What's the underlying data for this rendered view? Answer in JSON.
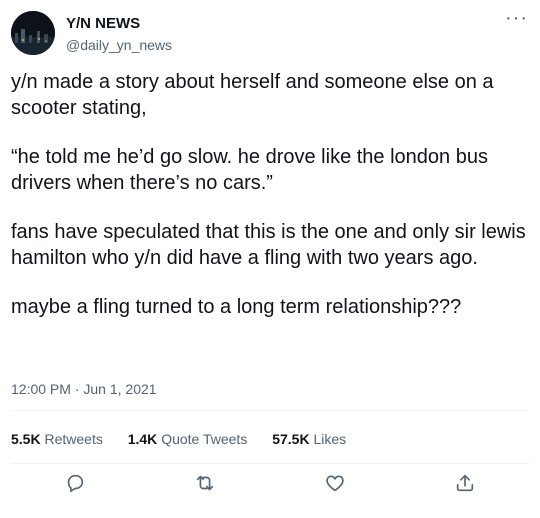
{
  "tweet": {
    "author_name": "Y/N NEWS",
    "author_handle": "@daily_yn_news",
    "more_label": "···",
    "paragraphs": [
      "y/n made a story about herself and someone else on a scooter stating,",
      "“he told me he’d go slow. he drove like the london bus drivers when there’s no cars.”",
      "fans have speculated that this is the one and only sir lewis hamilton who y/n did have a fling with two years ago.",
      "maybe a fling turned to a long term relationship???"
    ],
    "time": "12:00 PM",
    "separator": " · ",
    "date": "Jun 1, 2021",
    "stats": {
      "retweets_count": "5.5K",
      "retweets_label": "Retweets",
      "quotes_count": "1.4K",
      "quotes_label": "Quote Tweets",
      "likes_count": "57.5K",
      "likes_label": "Likes"
    }
  },
  "icons": [
    "reply-icon",
    "retweet-icon",
    "like-icon",
    "share-icon"
  ]
}
